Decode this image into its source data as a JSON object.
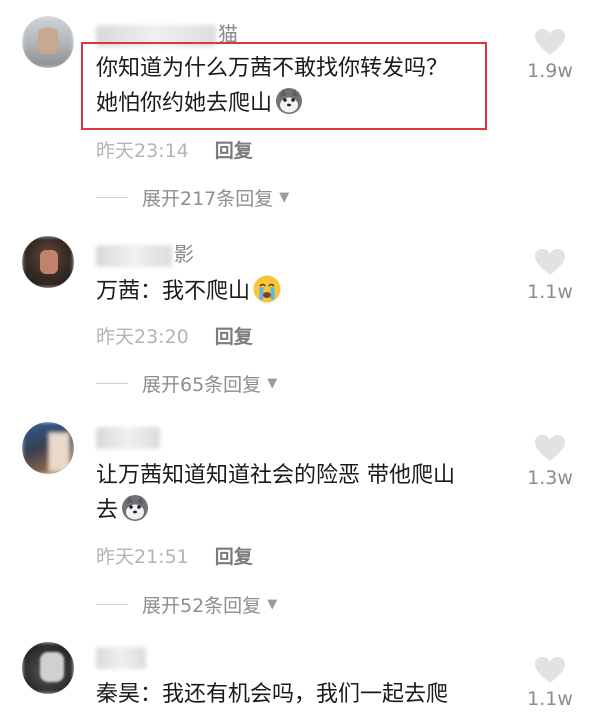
{
  "comments": [
    {
      "username_visible": "猫",
      "text_line1": "你知道为什么万茜不敢找你转发吗？",
      "text_line2": "她怕你约她去爬山",
      "time": "昨天23:14",
      "reply_label": "回复",
      "expand_label": "展开217条回复",
      "likes": "1.9w",
      "emoji": "husky-emoji"
    },
    {
      "username_visible": "影",
      "text_line1": "万茜：我不爬山",
      "time": "昨天23:20",
      "reply_label": "回复",
      "expand_label": "展开65条回复",
      "likes": "1.1w",
      "emoji": "crying-emoji"
    },
    {
      "username_visible": "",
      "text_line1": "让万茜知道知道社会的险恶 带他爬山",
      "text_line2": "去",
      "time": "昨天21:51",
      "reply_label": "回复",
      "expand_label": "展开52条回复",
      "likes": "1.3w",
      "emoji": "husky-emoji"
    },
    {
      "username_visible": "",
      "text_line1": "秦昊：我还有机会吗，我们一起去爬",
      "likes": "1.1w"
    }
  ],
  "colors": {
    "highlight_border": "#d9363e",
    "like_icon": "#e2e2e2"
  }
}
